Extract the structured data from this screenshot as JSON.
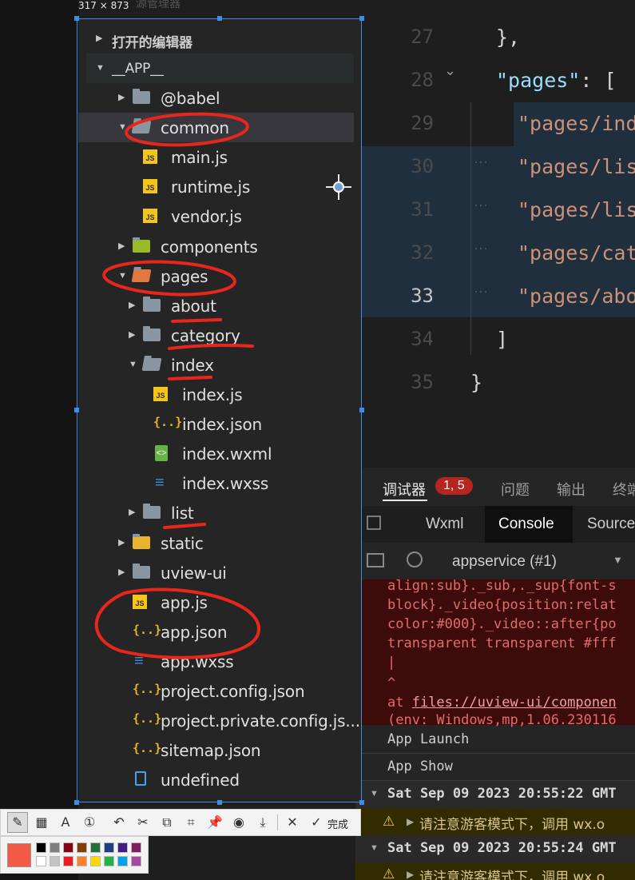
{
  "size_label": "317 × 873",
  "faint_title": "源管理器",
  "explorer": {
    "groups": [
      "打开的编辑器",
      "__APP__"
    ],
    "items": [
      {
        "label": "@babel",
        "type": "folder"
      },
      {
        "label": "common",
        "type": "folder-open"
      },
      {
        "label": "main.js",
        "type": "js"
      },
      {
        "label": "runtime.js",
        "type": "js"
      },
      {
        "label": "vendor.js",
        "type": "js"
      },
      {
        "label": "components",
        "type": "folder-special"
      },
      {
        "label": "pages",
        "type": "folder-open-special"
      },
      {
        "label": "about",
        "type": "folder"
      },
      {
        "label": "category",
        "type": "folder"
      },
      {
        "label": "index",
        "type": "folder-open"
      },
      {
        "label": "index.js",
        "type": "js"
      },
      {
        "label": "index.json",
        "type": "json"
      },
      {
        "label": "index.wxml",
        "type": "wxml"
      },
      {
        "label": "index.wxss",
        "type": "wxss"
      },
      {
        "label": "list",
        "type": "folder"
      },
      {
        "label": "static",
        "type": "folder-special"
      },
      {
        "label": "uview-ui",
        "type": "folder"
      },
      {
        "label": "app.js",
        "type": "js"
      },
      {
        "label": "app.json",
        "type": "json"
      },
      {
        "label": "app.wxss",
        "type": "wxss"
      },
      {
        "label": "project.config.json",
        "type": "json"
      },
      {
        "label": "project.private.config.js...",
        "type": "json"
      },
      {
        "label": "sitemap.json",
        "type": "json"
      },
      {
        "label": "undefined",
        "type": "file"
      }
    ],
    "js_icon_text": "JS",
    "json_icon_text": "{..}"
  },
  "editor": {
    "line_numbers": [
      "27",
      "28",
      "29",
      "30",
      "31",
      "32",
      "33",
      "34",
      "35"
    ],
    "lines": [
      "},",
      "\"pages\": [",
      "\"pages/ind",
      "\"pages/lis",
      "\"pages/lis",
      "\"pages/cat",
      "\"pages/abo",
      "]",
      "}"
    ],
    "pages_key": "\"pages\"",
    "pages_rest": ": ["
  },
  "debugger": {
    "tabs": [
      "调试器",
      "问题",
      "输出",
      "终端"
    ],
    "badge": "1, 5",
    "subtabs": [
      "Wxml",
      "Console",
      "Source"
    ],
    "context": "appservice (#1)",
    "error_lines": [
      "align:sub}._sub,._sup{font-s",
      "block}._video{position:relat",
      "color:#000}._video::after{po",
      "transparent transparent #fff",
      "      |",
      "^",
      "at files://uview-ui/componen",
      "(env: Windows,mp,1.06.230116"
    ],
    "at_prefix": "at ",
    "at_link": "files://uview-ui/componen",
    "log_lines": [
      "App Launch",
      "App Show"
    ],
    "groups": [
      {
        "header": "Sat Sep 09 2023 20:55:22 GMT",
        "warning": "请注意游客模式下，调用 wx.o"
      },
      {
        "header": "Sat Sep 09 2023 20:55:24 GMT",
        "warning": "请注意游客模式下，调用 wx.o"
      }
    ]
  },
  "toolbar": {
    "done_label": "完成",
    "icons": [
      "pen-icon",
      "mosaic-icon",
      "text-icon",
      "number-icon",
      "undo-icon",
      "crop-icon",
      "copy-icon",
      "ocr-icon",
      "pin-icon",
      "record-icon",
      "download-icon",
      "close-icon"
    ]
  },
  "palette": {
    "current": "#f25a45",
    "swatches": [
      "#000000",
      "#7f7f7f",
      "#880015",
      "#7f3f00",
      "#1f6f3f",
      "#1f3f7f",
      "#3f1f7f",
      "#7f1f5f",
      "#ffffff",
      "#c3c3c3",
      "#ed1c24",
      "#ff7f27",
      "#ffd800",
      "#22b14c",
      "#00a2e8",
      "#a349a4"
    ]
  }
}
